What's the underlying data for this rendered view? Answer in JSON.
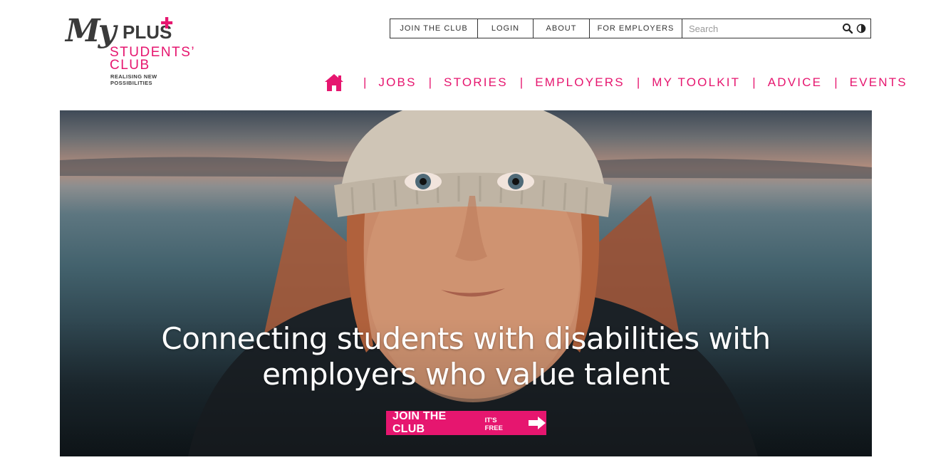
{
  "brand": {
    "my": "My",
    "plus": "PLUS",
    "students": "STUDENTS’",
    "club": "CLUB",
    "tagline_1": "REALISING NEW",
    "tagline_2": "POSSIBILITIES",
    "accent_color": "#e6166f"
  },
  "topbar": {
    "links": [
      "JOIN THE CLUB",
      "LOGIN",
      "ABOUT",
      "FOR EMPLOYERS"
    ],
    "search_placeholder": "Search",
    "search_value": ""
  },
  "nav": {
    "items": [
      "JOBS",
      "STORIES",
      "EMPLOYERS",
      "MY TOOLKIT",
      "ADVICE",
      "EVENTS"
    ],
    "separator": "|"
  },
  "hero": {
    "heading_line1": "Connecting students with disabilities with",
    "heading_line2": "employers who value talent",
    "cta_main": "JOIN THE CLUB",
    "cta_sub": "IT'S FREE"
  }
}
